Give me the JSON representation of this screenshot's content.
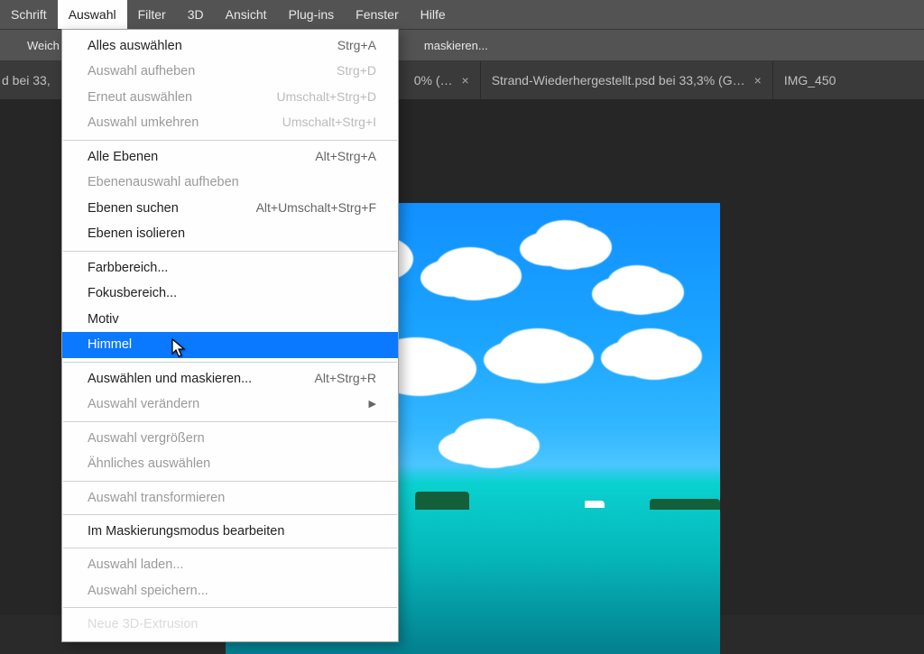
{
  "menubar": [
    "Schrift",
    "Auswahl",
    "Filter",
    "3D",
    "Ansicht",
    "Plug-ins",
    "Fenster",
    "Hilfe"
  ],
  "menubar_active_index": 1,
  "options_bar": {
    "left_button": "Weich",
    "right_button": "maskieren..."
  },
  "tabs": [
    {
      "label": "d bei 33,",
      "closable": false,
      "truncated_left": true
    },
    {
      "label": "0% (…",
      "closable": true
    },
    {
      "label": "Strand-Wiederhergestellt.psd bei 33,3% (G…",
      "closable": true
    },
    {
      "label": "IMG_450",
      "closable": false,
      "truncated_right": true
    }
  ],
  "dropdown": {
    "groups": [
      [
        {
          "label": "Alles auswählen",
          "shortcut": "Strg+A",
          "enabled": true
        },
        {
          "label": "Auswahl aufheben",
          "shortcut": "Strg+D",
          "enabled": false
        },
        {
          "label": "Erneut auswählen",
          "shortcut": "Umschalt+Strg+D",
          "enabled": false
        },
        {
          "label": "Auswahl umkehren",
          "shortcut": "Umschalt+Strg+I",
          "enabled": false
        }
      ],
      [
        {
          "label": "Alle Ebenen",
          "shortcut": "Alt+Strg+A",
          "enabled": true
        },
        {
          "label": "Ebenenauswahl aufheben",
          "shortcut": "",
          "enabled": false
        },
        {
          "label": "Ebenen suchen",
          "shortcut": "Alt+Umschalt+Strg+F",
          "enabled": true
        },
        {
          "label": "Ebenen isolieren",
          "shortcut": "",
          "enabled": true
        }
      ],
      [
        {
          "label": "Farbbereich...",
          "shortcut": "",
          "enabled": true
        },
        {
          "label": "Fokusbereich...",
          "shortcut": "",
          "enabled": true
        },
        {
          "label": "Motiv",
          "shortcut": "",
          "enabled": true
        },
        {
          "label": "Himmel",
          "shortcut": "",
          "enabled": true,
          "highlight": true
        }
      ],
      [
        {
          "label": "Auswählen und maskieren...",
          "shortcut": "Alt+Strg+R",
          "enabled": true
        },
        {
          "label": "Auswahl verändern",
          "shortcut": "",
          "enabled": false,
          "submenu": true
        }
      ],
      [
        {
          "label": "Auswahl vergrößern",
          "shortcut": "",
          "enabled": false
        },
        {
          "label": "Ähnliches auswählen",
          "shortcut": "",
          "enabled": false
        }
      ],
      [
        {
          "label": "Auswahl transformieren",
          "shortcut": "",
          "enabled": false
        }
      ],
      [
        {
          "label": "Im Maskierungsmodus bearbeiten",
          "shortcut": "",
          "enabled": true
        }
      ],
      [
        {
          "label": "Auswahl laden...",
          "shortcut": "",
          "enabled": false
        },
        {
          "label": "Auswahl speichern...",
          "shortcut": "",
          "enabled": false
        }
      ],
      [
        {
          "label": "Neue 3D-Extrusion",
          "shortcut": "",
          "enabled": false
        }
      ]
    ]
  }
}
